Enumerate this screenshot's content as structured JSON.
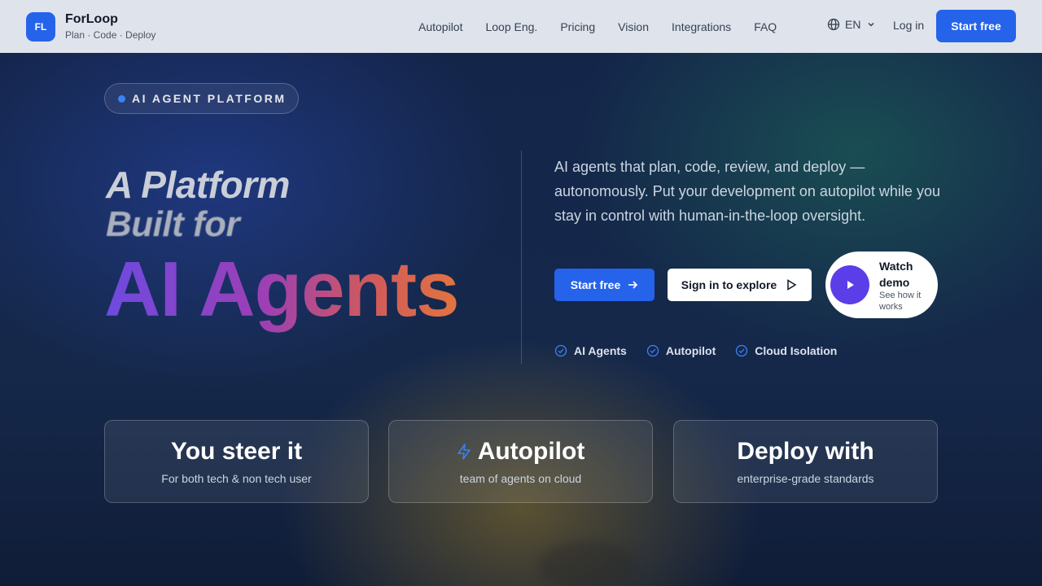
{
  "header": {
    "logo_text": "FL",
    "brand_name": "ForLoop",
    "brand_tagline": "Plan · Code · Deploy",
    "nav": [
      "Autopilot",
      "Loop Eng.",
      "Pricing",
      "Vision",
      "Integrations",
      "FAQ"
    ],
    "language": "EN",
    "login_label": "Log in",
    "cta_label": "Start free",
    "accent_color": "#2563eb"
  },
  "hero": {
    "badge": "AI AGENT PLATFORM",
    "heading_line1": "A Platform",
    "heading_line2": "Built for",
    "heading_big": "AI Agents",
    "description": "AI agents that plan, code, review, and deploy — autonomously. Put your development on autopilot while you stay in control with human-in-the-loop oversight.",
    "primary_button": "Start free",
    "secondary_button": "Sign in to explore",
    "demo_title": "Watch demo",
    "demo_subtitle": "See how it works",
    "features": [
      "AI Agents",
      "Autopilot",
      "Cloud Isolation"
    ]
  },
  "cards": [
    {
      "title": "You steer it",
      "subtitle": "For both tech & non tech user",
      "icon": ""
    },
    {
      "title": "Autopilot",
      "subtitle": "team of agents on cloud",
      "icon": "lightning-icon"
    },
    {
      "title": "Deploy with",
      "subtitle": "enterprise-grade standards",
      "icon": ""
    }
  ]
}
